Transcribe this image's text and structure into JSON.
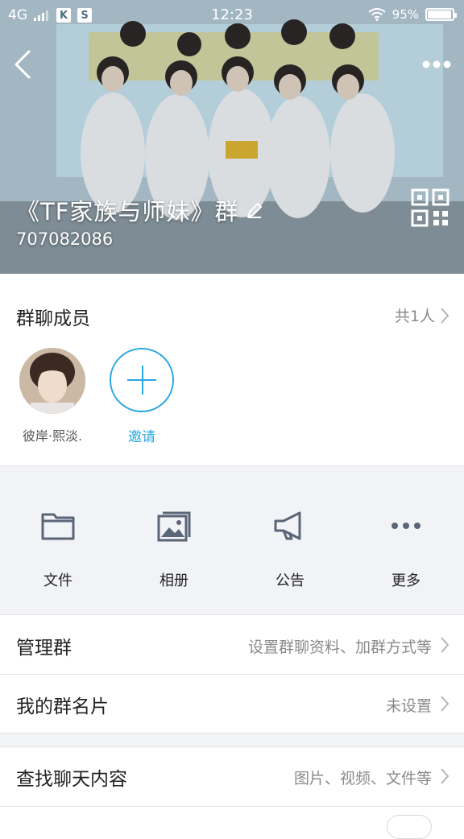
{
  "status_bar": {
    "network": "4G",
    "time": "12:23",
    "battery": "95%",
    "battery_level": 0.95
  },
  "header": {
    "group_name": "《TF家族与师妹》群",
    "group_id": "707082086"
  },
  "members": {
    "title": "群聊成员",
    "count": "共1人",
    "member_name": "彼岸·熙淡.",
    "invite_label": "邀请"
  },
  "actions": [
    {
      "label": "文件",
      "icon": "folder-icon"
    },
    {
      "label": "相册",
      "icon": "album-icon"
    },
    {
      "label": "公告",
      "icon": "megaphone-icon"
    },
    {
      "label": "更多",
      "icon": "more-dots-icon"
    }
  ],
  "settings": {
    "manage": {
      "title": "管理群",
      "value": "设置群聊资料、加群方式等"
    },
    "card": {
      "title": "我的群名片",
      "value": "未设置"
    },
    "search": {
      "title": "查找聊天内容",
      "value": "图片、视频、文件等"
    }
  },
  "colors": {
    "accent": "#29a7e1",
    "icon_gray": "#5a6577",
    "section_bg": "#f2f3f7"
  }
}
